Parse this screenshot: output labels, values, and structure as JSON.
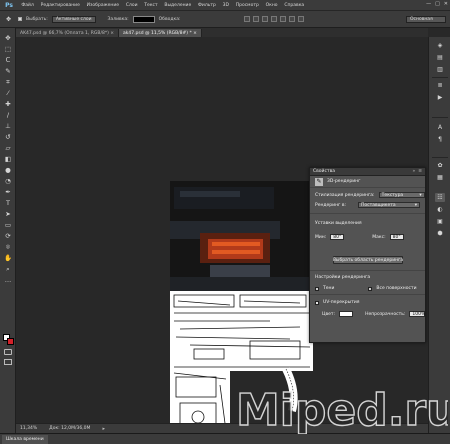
{
  "app": {
    "logo": "Ps"
  },
  "menu": [
    "Файл",
    "Редактирование",
    "Изображение",
    "Слои",
    "Текст",
    "Выделение",
    "Фильтр",
    "3D",
    "Просмотр",
    "Окно",
    "Справка"
  ],
  "window_controls": [
    "—",
    "□",
    "✕"
  ],
  "options_bar": {
    "select_label": "Выбрать:",
    "select_value": "Активные слои",
    "fill_label": "Заливка:",
    "stroke_label": "Обводка:",
    "workspace": "Основная"
  },
  "tabs": [
    {
      "title": "AK47.psd @ 66,7% (Оплата 1, RGB/8*) ×",
      "active": false
    },
    {
      "title": "ak47.psd @ 11,5% (RGB/8#) * ×",
      "active": true
    }
  ],
  "properties": {
    "tab": "Свойства",
    "controls": [
      "»",
      "≡"
    ],
    "header_title": "3D-рендеринг",
    "preset_label": "Стилизация рендеринга:",
    "preset_value": "Текстура",
    "render_label": "Рендеринг в:",
    "render_value": "Поставщикета",
    "section_label": "Уставки выделения",
    "min_label": "Мин:",
    "min_value": "80°",
    "max_label": "Макс:",
    "max_value": "80°",
    "button_label": "Выбрать область рендеринга",
    "render_settings_label": "Настройки рендеринга",
    "shadow_label": "Тени",
    "all_overlays_label": "Все поверхности",
    "uv_label": "UV-перекрытия",
    "color_label": "Цвет:",
    "opacity_label": "Непрозрачность:",
    "opacity_value": "100%"
  },
  "status": {
    "zoom": "11,34%",
    "doc": "Док: 12,0М/36,0М"
  },
  "timeline": {
    "tab": "Шкала времени"
  },
  "watermark": "Miped.ru",
  "colors": {
    "foreground": "#ffffff",
    "background": "#d3212a",
    "ps_blue": "#7ec4f0"
  }
}
